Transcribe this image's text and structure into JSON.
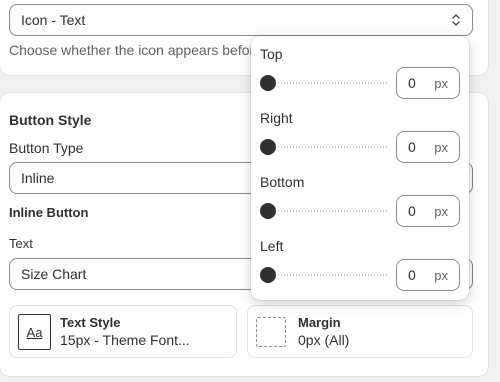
{
  "icon_position": {
    "selected": "Icon - Text",
    "help_text": "Choose whether the icon appears before or after the text"
  },
  "button_style": {
    "heading": "Button Style",
    "type_label": "Button Type",
    "type_selected": "Inline",
    "inline_heading": "Inline Button",
    "text_label": "Text",
    "text_selected": "Size Chart",
    "text_style": {
      "title": "Text Style",
      "value": "15px - Theme Font...",
      "icon_glyph": "Aa"
    },
    "margin": {
      "title": "Margin",
      "value": "0px (All)"
    }
  },
  "margin_popover": {
    "rows": [
      {
        "label": "Top",
        "value": "0",
        "unit": "px",
        "level": 0
      },
      {
        "label": "Right",
        "value": "0",
        "unit": "px",
        "level": 0
      },
      {
        "label": "Bottom",
        "value": "0",
        "unit": "px",
        "level": 0
      },
      {
        "label": "Left",
        "value": "0",
        "unit": "px",
        "level": 0
      }
    ]
  },
  "colors": {
    "text": "#303030",
    "border": "#8a8a8a",
    "background": "#f1f1f1",
    "thumb": "#303030"
  }
}
